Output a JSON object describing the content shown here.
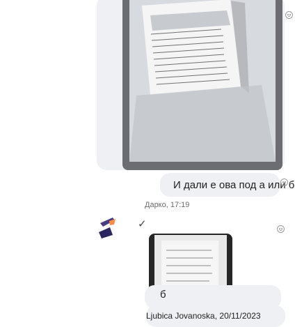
{
  "message1": {
    "text": "И дали е ова под а или б"
  },
  "message2": {
    "sender_time": "Дарко, 17:19",
    "reaction": "✓"
  },
  "message3": {
    "caption": "Ljubica Jovanoska, 20/11/2023"
  },
  "message4": {
    "text": "б"
  },
  "colors": {
    "bubble": "#eef0f3",
    "text": "#1f1f1f",
    "meta": "#6b6b6b"
  },
  "icons": [
    "reaction-icon",
    "avatar-icon",
    "checkmark-icon"
  ]
}
